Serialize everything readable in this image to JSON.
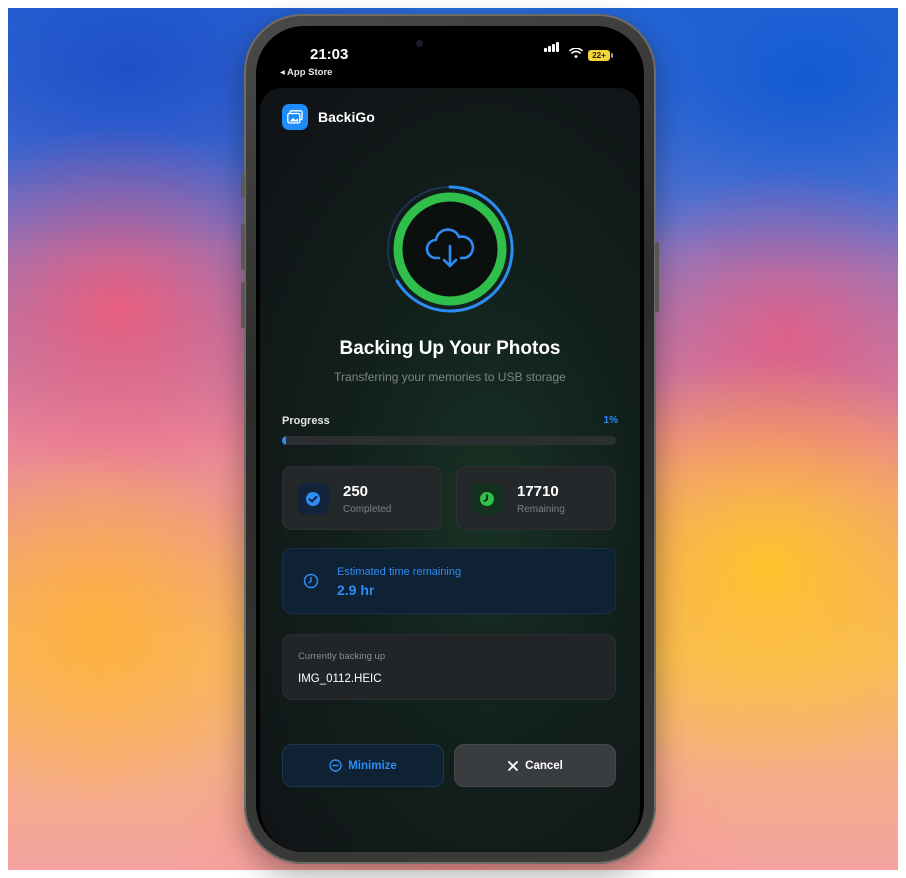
{
  "status_bar": {
    "time": "21:03",
    "back_label": "◂ App Store",
    "battery": "22+"
  },
  "app": {
    "name": "BackiGo",
    "icon": "photos-icon",
    "brand_color": "#1d8cf8",
    "accent_green": "#2fbf4a",
    "accent_blue": "#2d8df5"
  },
  "hero": {
    "icon": "cloud-download-icon",
    "title": "Backing Up Your Photos",
    "subtitle": "Transferring your memories to USB storage"
  },
  "progress": {
    "label": "Progress",
    "percent_text": "1%",
    "fraction": 0.01
  },
  "stats": {
    "completed": {
      "value": "250",
      "label": "Completed",
      "icon": "checkmark-circle-icon"
    },
    "remaining": {
      "value": "17710",
      "label": "Remaining",
      "icon": "clock-icon"
    }
  },
  "eta": {
    "label": "Estimated time remaining",
    "value": "2.9 hr",
    "icon": "clock-icon"
  },
  "current": {
    "label": "Currently backing up",
    "file": "IMG_0112.HEIC"
  },
  "buttons": {
    "minimize": "Minimize",
    "cancel": "Cancel"
  }
}
